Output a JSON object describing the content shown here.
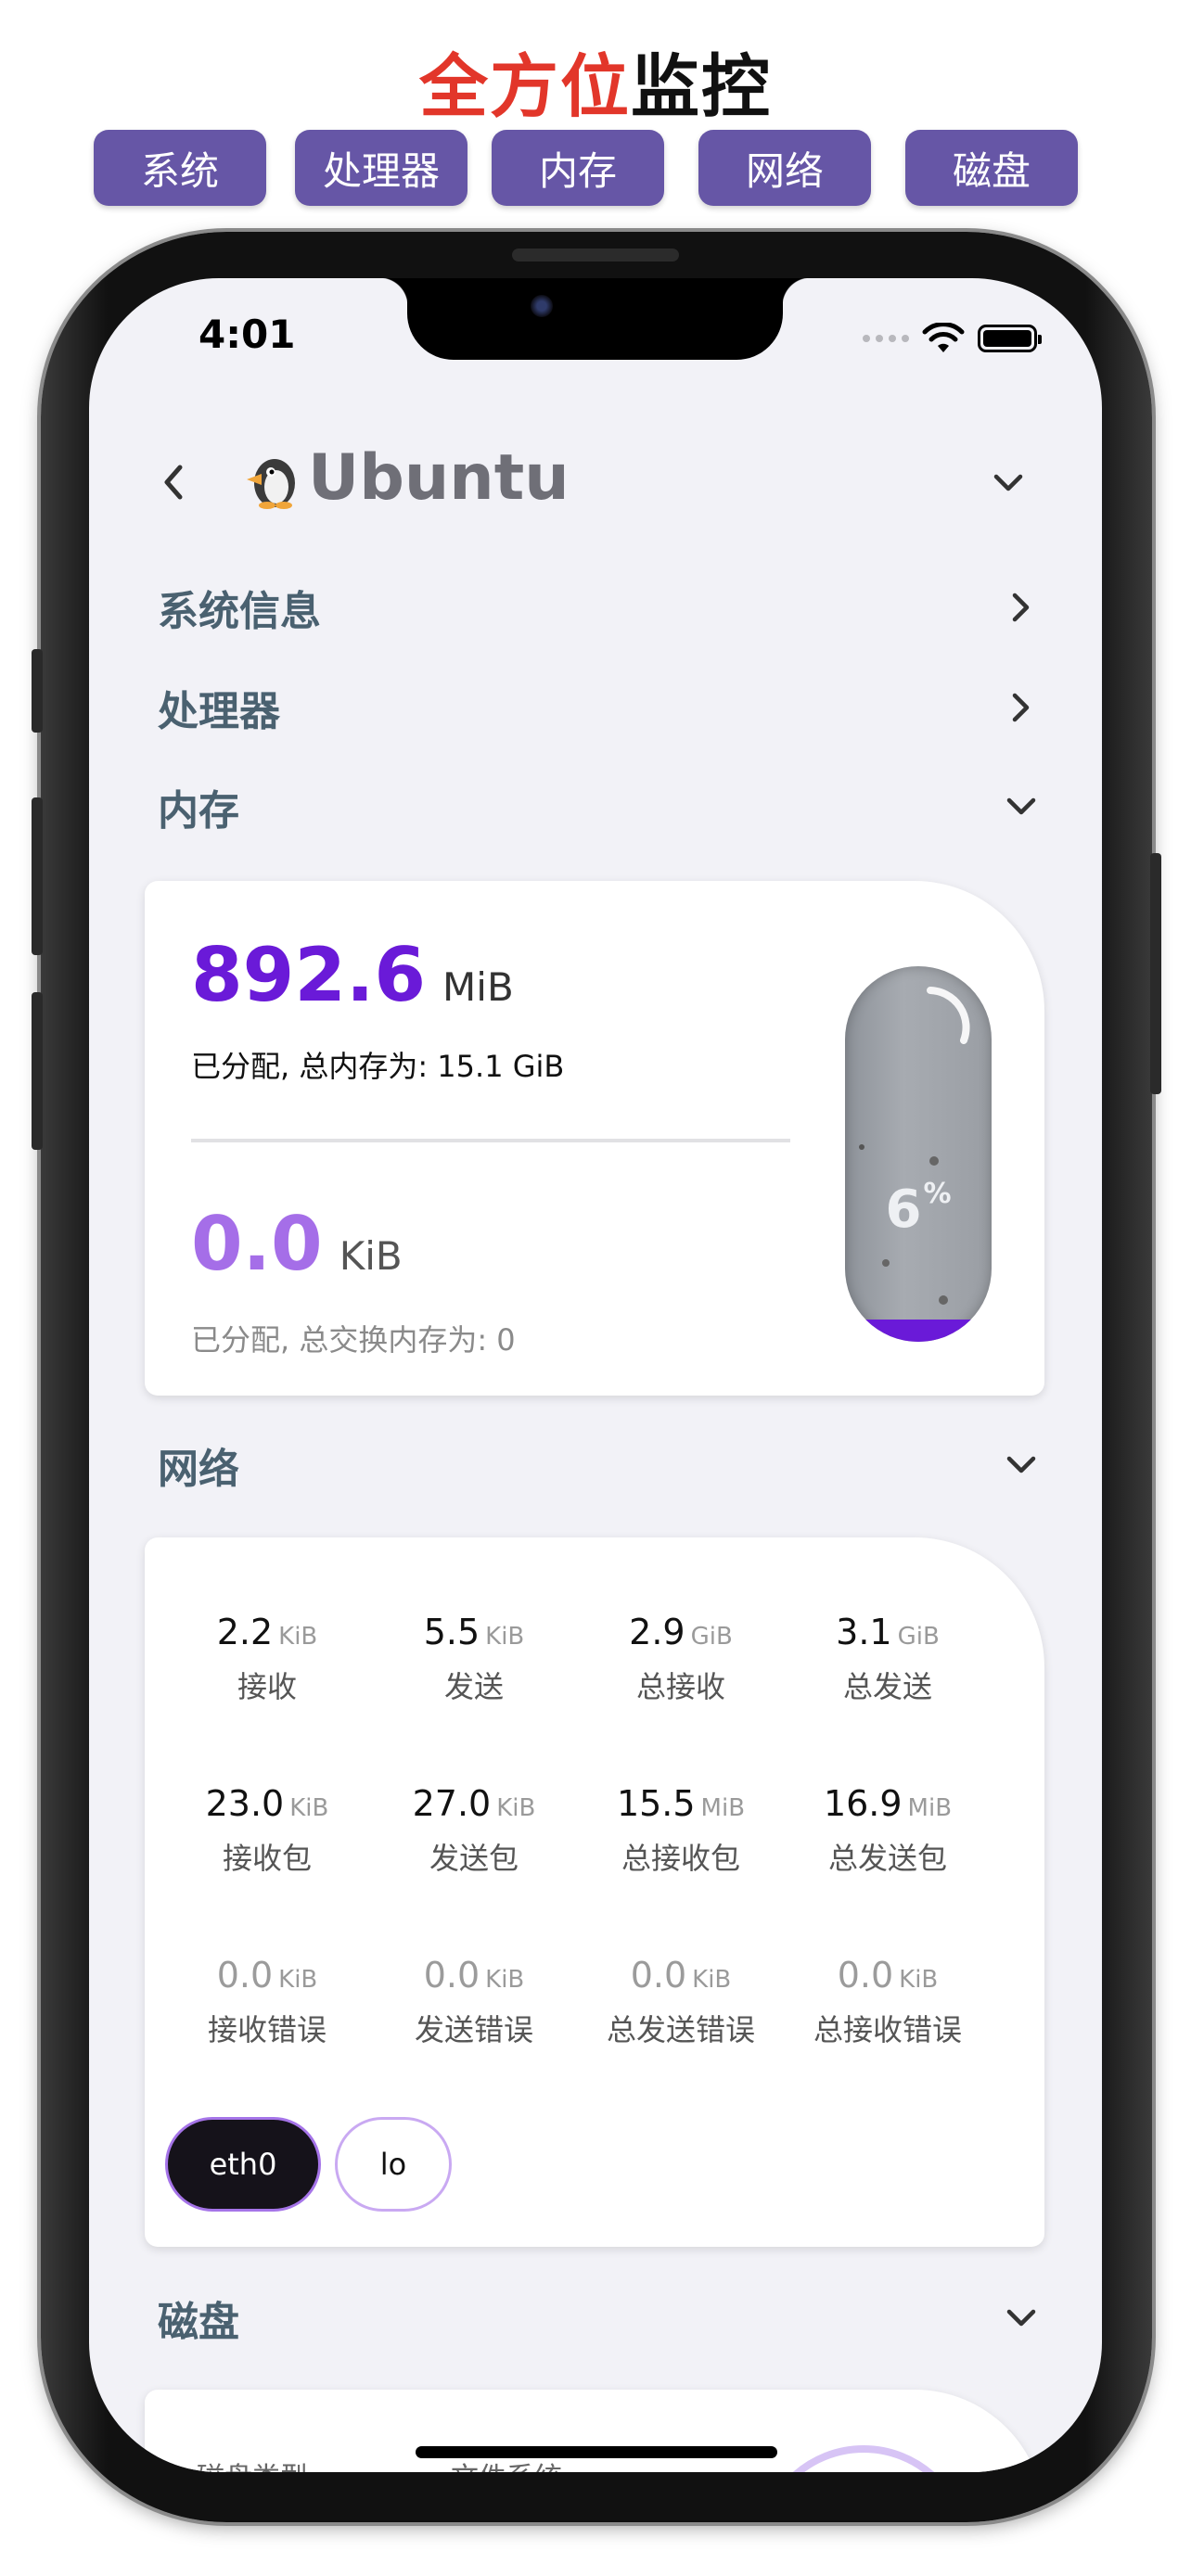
{
  "promo": {
    "title_red": "全方位",
    "title_black": "监控",
    "chips": [
      "系统",
      "处理器",
      "内存",
      "网络",
      "磁盘"
    ]
  },
  "status_bar": {
    "time": "4:01"
  },
  "header": {
    "title": "Ubuntu",
    "logo_icon": "penguin-icon"
  },
  "sections": {
    "system": "系统信息",
    "cpu": "处理器",
    "memory": "内存",
    "network": "网络",
    "disk": "磁盘"
  },
  "memory": {
    "ram_value": "892.6",
    "ram_unit": "MiB",
    "ram_caption": "已分配, 总内存为: 15.1 GiB",
    "swap_value": "0.0",
    "swap_unit": "KiB",
    "swap_caption": "已分配, 总交换内存为: 0",
    "usage_percent": 6,
    "usage_label": "6",
    "usage_symbol": "%"
  },
  "network": {
    "rows": [
      [
        {
          "value": "2.2",
          "unit": "KiB",
          "label": "接收"
        },
        {
          "value": "5.5",
          "unit": "KiB",
          "label": "发送"
        },
        {
          "value": "2.9",
          "unit": "GiB",
          "label": "总接收"
        },
        {
          "value": "3.1",
          "unit": "GiB",
          "label": "总发送"
        }
      ],
      [
        {
          "value": "23.0",
          "unit": "KiB",
          "label": "接收包"
        },
        {
          "value": "27.0",
          "unit": "KiB",
          "label": "发送包"
        },
        {
          "value": "15.5",
          "unit": "MiB",
          "label": "总接收包"
        },
        {
          "value": "16.9",
          "unit": "MiB",
          "label": "总发送包"
        }
      ],
      [
        {
          "value": "0.0",
          "unit": "KiB",
          "label": "接收错误"
        },
        {
          "value": "0.0",
          "unit": "KiB",
          "label": "发送错误"
        },
        {
          "value": "0.0",
          "unit": "KiB",
          "label": "总发送错误"
        },
        {
          "value": "0.0",
          "unit": "KiB",
          "label": "总接收错误"
        }
      ]
    ],
    "interfaces": [
      "eth0",
      "lo"
    ],
    "selected_interface": "eth0"
  },
  "disk": {
    "col1": "磁盘类型",
    "col2": "文件系统"
  },
  "colors": {
    "accent_purple": "#6a1ad8",
    "chip_purple": "#6656a6",
    "promo_red": "#e2362a",
    "section_label": "#4a6170"
  }
}
